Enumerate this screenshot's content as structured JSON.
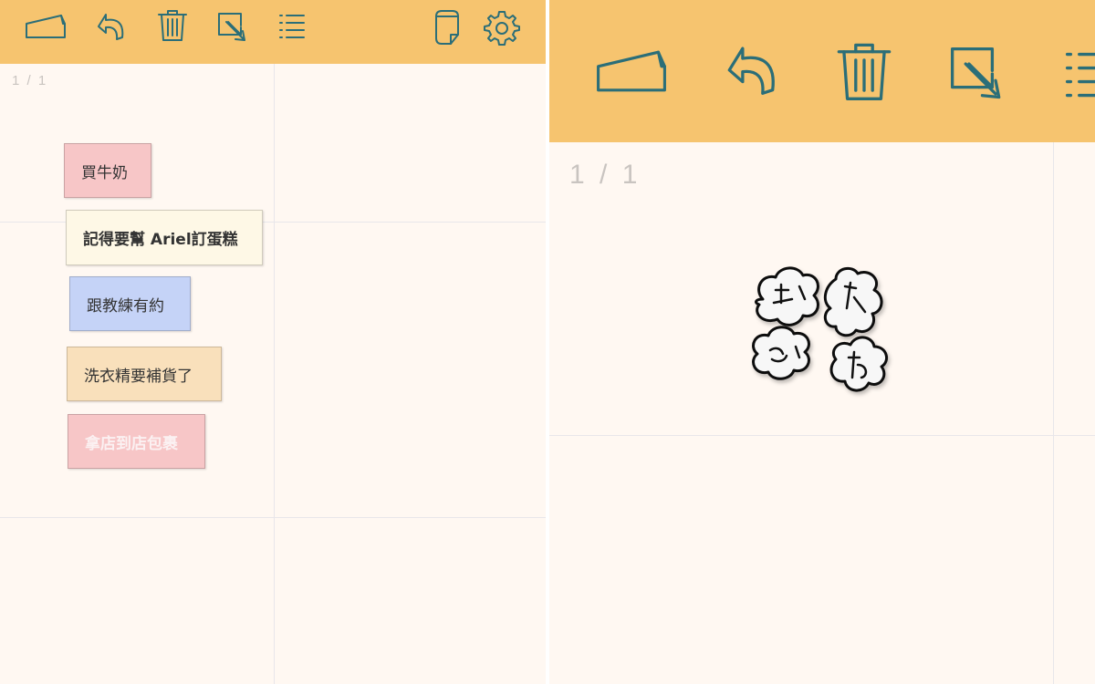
{
  "left_panel": {
    "toolbar": {
      "icons": [
        "sticky-note-icon",
        "undo-icon",
        "trash-icon",
        "export-icon",
        "list-icon",
        "device-icon",
        "gear-icon"
      ]
    },
    "page_indicator": "1 / 1",
    "notes": [
      {
        "text": "買牛奶",
        "color": "#f7c6c7"
      },
      {
        "text": "記得要幫 Ariel訂蛋糕",
        "color": "#fef8e6"
      },
      {
        "text": "跟教練有約",
        "color": "#c5d3f7"
      },
      {
        "text": "洗衣精要補貨了",
        "color": "#f9e0bb"
      },
      {
        "text": "拿店到店包裹",
        "color": "#f7c6c7"
      }
    ]
  },
  "right_panel": {
    "toolbar": {
      "icons": [
        "sticky-note-icon",
        "undo-icon",
        "trash-icon",
        "export-icon",
        "list-icon"
      ]
    },
    "page_indicator": "1 / 1",
    "sticker": {
      "name": "cloud-doodle-sticker"
    }
  },
  "colors": {
    "toolbar": "#f6c46f",
    "icon": "#2b6e78",
    "board": "#fff8f2",
    "grid": "#e8e6ea"
  }
}
